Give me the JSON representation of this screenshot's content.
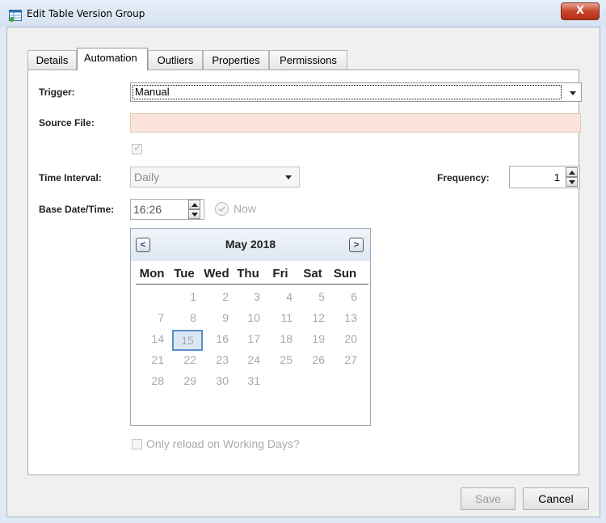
{
  "window": {
    "title": "Edit Table Version Group",
    "close_label": "X"
  },
  "tabs": [
    {
      "label": "Details",
      "active": false
    },
    {
      "label": "Automation",
      "active": true
    },
    {
      "label": "Outliers",
      "active": false
    },
    {
      "label": "Properties",
      "active": false
    },
    {
      "label": "Permissions",
      "active": false
    }
  ],
  "form": {
    "trigger_label": "Trigger:",
    "trigger_value": "Manual",
    "source_file_label": "Source File:",
    "source_file_value": "",
    "enabled_checkbox_checked": true,
    "time_interval_label": "Time Interval:",
    "time_interval_value": "Daily",
    "frequency_label": "Frequency:",
    "frequency_value": "1",
    "base_datetime_label": "Base Date/Time:",
    "time_value": "16:26",
    "now_label": "Now",
    "reload_label": "Only reload on Working Days?",
    "reload_checked": false
  },
  "calendar": {
    "month_title": "May 2018",
    "prev_label": "<",
    "next_label": ">",
    "days_of_week": [
      "Mon",
      "Tue",
      "Wed",
      "Thu",
      "Fri",
      "Sat",
      "Sun"
    ],
    "weeks": [
      [
        "",
        "1",
        "2",
        "3",
        "4",
        "5",
        "6"
      ],
      [
        "7",
        "8",
        "9",
        "10",
        "11",
        "12",
        "13"
      ],
      [
        "14",
        "15",
        "16",
        "17",
        "18",
        "19",
        "20"
      ],
      [
        "21",
        "22",
        "23",
        "24",
        "25",
        "26",
        "27"
      ],
      [
        "28",
        "29",
        "30",
        "31",
        "",
        "",
        ""
      ]
    ],
    "selected_day": "15"
  },
  "buttons": {
    "save": "Save",
    "cancel": "Cancel"
  },
  "colors": {
    "required_field": "#fbe5da",
    "selected_day_border": "#5b8fc9"
  }
}
